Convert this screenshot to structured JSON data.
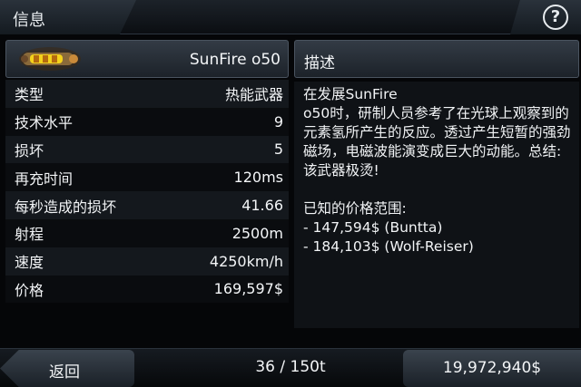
{
  "header": {
    "title": "信息",
    "help_icon": "?"
  },
  "item": {
    "name": "SunFire o50",
    "icon": "weapon-icon",
    "stats": [
      {
        "label": "类型",
        "value": "热能武器"
      },
      {
        "label": "技术水平",
        "value": "9"
      },
      {
        "label": "损坏",
        "value": "5"
      },
      {
        "label": "再充时间",
        "value": "120ms"
      },
      {
        "label": "每秒造成的损坏",
        "value": "41.66"
      },
      {
        "label": "射程",
        "value": "2500m"
      },
      {
        "label": "速度",
        "value": "4250km/h"
      },
      {
        "label": "价格",
        "value": "169,597$"
      }
    ]
  },
  "description": {
    "title": "描述",
    "text": "在发展SunFire\no50时，研制人员参考了在光球上观察到的元素氢所产生的反应。透过产生短暂的强劲磁场，电磁波能演变成巨大的动能。总结:该武器极烫!",
    "price_heading": "已知的价格范围:",
    "prices": [
      "- 147,594$ (Buntta)",
      "- 184,103$ (Wolf-Reiser)"
    ]
  },
  "footer": {
    "back_label": "返回",
    "cargo": "36 / 150t",
    "money": "19,972,940$"
  },
  "colors": {
    "accent_yellow": "#f4d21c",
    "panel_bg": "#14181d"
  }
}
